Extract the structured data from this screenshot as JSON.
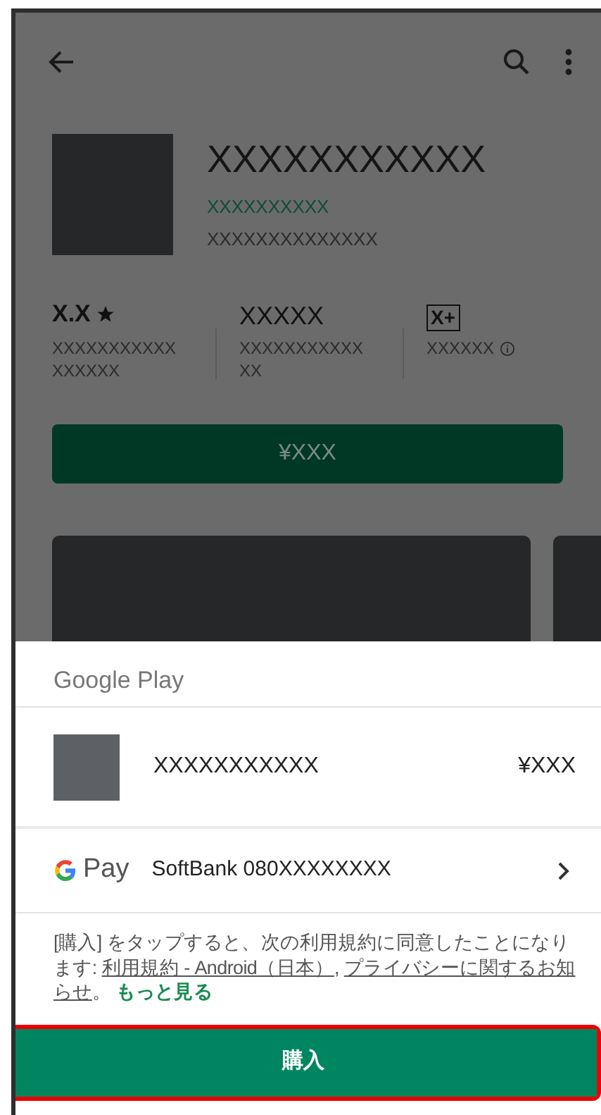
{
  "app": {
    "title": "XXXXXXXXXXX",
    "developer": "XXXXXXXXXX",
    "category": "XXXXXXXXXXXXXX"
  },
  "stats": [
    {
      "kind": "rating",
      "value": "X.X",
      "label": "XXXXXXXXXXX XXXXXX"
    },
    {
      "kind": "text",
      "value": "XXXXX",
      "label": "XXXXXXXXXXX XX"
    },
    {
      "kind": "content_rating",
      "value": "X+",
      "label": "XXXXXX"
    }
  ],
  "price_button": "¥XXX",
  "sheet": {
    "header": "Google Play",
    "item": {
      "name": "XXXXXXXXXXX",
      "price": "¥XXX"
    },
    "payment": {
      "brand": "Pay",
      "method": "SoftBank 080XXXXXXXX"
    },
    "legal": [
      {
        "kind": "text",
        "text": "[購入] をタップすると、次の利用規約に同意したことになります: "
      },
      {
        "kind": "link",
        "text": "利用規約 - Android（日本）"
      },
      {
        "kind": "text",
        "text": ", "
      },
      {
        "kind": "link",
        "text": "プライバシーに関するお知"
      },
      {
        "kind": "link",
        "text": "らせ"
      },
      {
        "kind": "text",
        "text": "。 "
      },
      {
        "kind": "more",
        "text": "もっと見る"
      }
    ],
    "buy_button": {
      "label": "購入",
      "highlighted": true
    }
  }
}
